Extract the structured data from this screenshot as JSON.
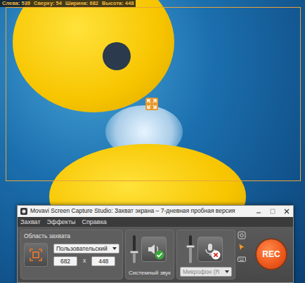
{
  "capture_info": [
    "Слева: 539",
    "Сверху: 54",
    "Ширина: 682",
    "Высота: 448"
  ],
  "window": {
    "title": "Movavi Screen Capture Studio: Захват экрана – 7-дневная пробная версия"
  },
  "menu": [
    "Захват",
    "Эффекты",
    "Справка"
  ],
  "capture_area": {
    "label": "Область захвата",
    "preset": "Пользовательский",
    "width": "682",
    "separator": "x",
    "height": "448"
  },
  "system_sound": {
    "label": "Системный звук",
    "level": 0.4,
    "on": true
  },
  "microphone": {
    "device": "Микрофон (R",
    "level": 0.6,
    "on": false
  },
  "rec_button": "REC"
}
